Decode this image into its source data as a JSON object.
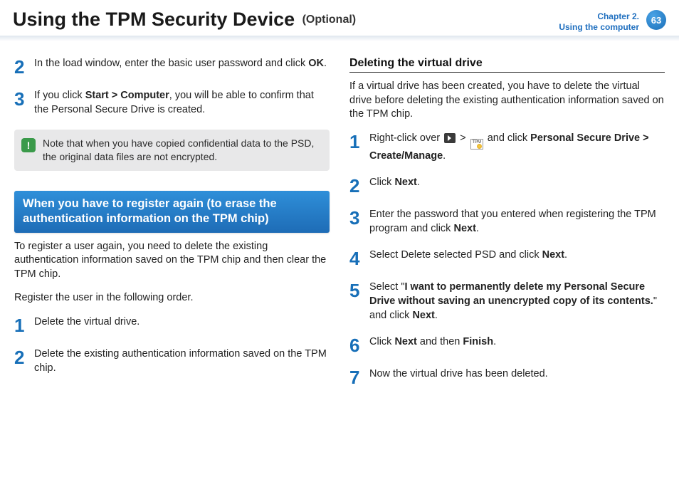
{
  "header": {
    "title": "Using the TPM Security Device",
    "optional": "(Optional)",
    "chapter_line1": "Chapter 2.",
    "chapter_line2": "Using the computer",
    "page_number": "63"
  },
  "left": {
    "step2_a": "In the load window, enter the basic user password and click ",
    "step2_b": "OK",
    "step2_c": ".",
    "step3_a": "If you click ",
    "step3_b": "Start > Computer",
    "step3_c": ", you will be able to confirm that the Personal Secure Drive is created.",
    "note": "Note that when you have copied confidential data to the PSD, the original data files are not encrypted.",
    "blue_heading": "When you have to register again (to erase the authentication information on the TPM chip)",
    "para1": "To register a user again, you need to delete the existing authentication information saved on the TPM chip and then clear the TPM chip.",
    "para2": "Register the user in the following order.",
    "rstep1": "Delete the virtual drive.",
    "rstep2": "Delete the existing authentication information saved on the TPM chip."
  },
  "right": {
    "heading": "Deleting the virtual drive",
    "intro": "If a virtual drive has been created, you have to delete the virtual drive before deleting the existing authentication information saved on the TPM chip.",
    "d1_a": "Right-click over ",
    "d1_b": " > ",
    "d1_c": " and click ",
    "d1_d": "Personal Secure Drive > Create/Manage",
    "d1_e": ".",
    "d2_a": "Click ",
    "d2_b": "Next",
    "d2_c": ".",
    "d3_a": "Enter the password that you entered when registering the TPM program and click ",
    "d3_b": "Next",
    "d3_c": ".",
    "d4_a": "Select Delete selected PSD and click ",
    "d4_b": "Next",
    "d4_c": ".",
    "d5_a": "Select \"",
    "d5_b": "I want to permanently delete my Personal Secure Drive without saving an unencrypted copy of its contents.",
    "d5_c": "\" and click ",
    "d5_d": "Next",
    "d5_e": ".",
    "d6_a": "Click ",
    "d6_b": "Next",
    "d6_c": " and then ",
    "d6_d": "Finish",
    "d6_e": ".",
    "d7": "Now the virtual drive has been deleted."
  },
  "numbers": {
    "n1": "1",
    "n2": "2",
    "n3": "3",
    "n4": "4",
    "n5": "5",
    "n6": "6",
    "n7": "7"
  },
  "icons": {
    "tpm_label": "TPM"
  }
}
